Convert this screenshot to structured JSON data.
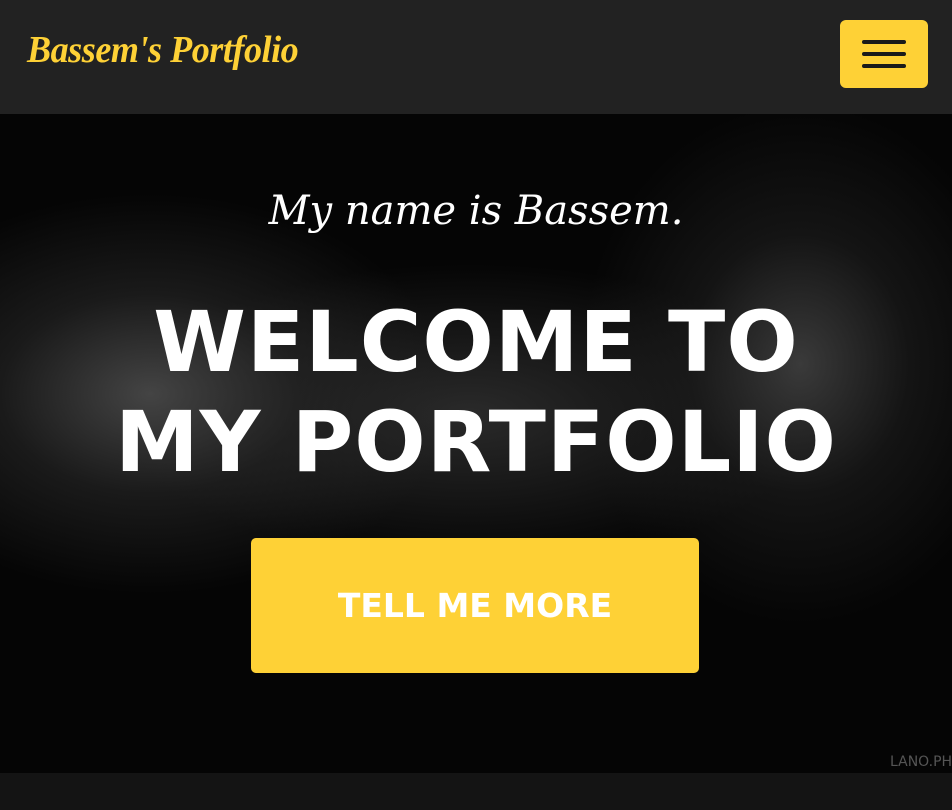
{
  "nav": {
    "brand": "Bassem's Portfolio",
    "menu_icon": "hamburger-icon"
  },
  "hero": {
    "subheading": "My name is Bassem.",
    "heading_line1": "WELCOME TO",
    "heading_line2": "MY PORTFOLIO",
    "cta_label": "TELL ME MORE",
    "photo_credit": "LANO.PH"
  },
  "colors": {
    "accent": "#fed136",
    "nav_bg": "#222222"
  }
}
